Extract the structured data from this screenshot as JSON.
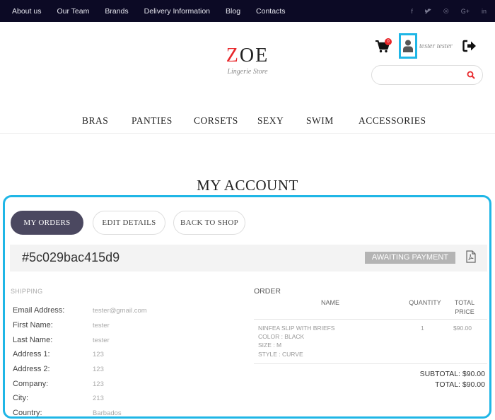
{
  "topnav": {
    "links": [
      "About us",
      "Our Team",
      "Brands",
      "Delivery Information",
      "Blog",
      "Contacts"
    ]
  },
  "social": {
    "icons": [
      "facebook-icon",
      "twitter-icon",
      "instagram-icon",
      "google-plus-icon",
      "linkedin-icon"
    ],
    "glyphs": [
      "f",
      "t",
      "◎",
      "G+",
      "in"
    ]
  },
  "header": {
    "logo_first": "Z",
    "logo_rest": "OE",
    "logo_tagline": "Lingerie Store",
    "cart_count": "0",
    "user_name": "tester tester",
    "search_placeholder": ""
  },
  "colors": {
    "topbar": "#0c0a25",
    "accent": "#e8262a",
    "highlight": "#1fb6e6",
    "active_tab": "#4b4860"
  },
  "mainnav": [
    "BRAS",
    "PANTIES",
    "CORSETS",
    "SEXY",
    "SWIM",
    "ACCESSORIES"
  ],
  "page": {
    "title": "MY ACCOUNT"
  },
  "tabs": [
    "MY ORDERS",
    "EDIT DETAILS",
    "BACK TO SHOP"
  ],
  "order": {
    "id": "#5c029bac415d9",
    "status": "AWAITING PAYMENT",
    "shipping_heading": "SHIPPING",
    "shipping": [
      {
        "label": "Email Address:",
        "value": "tester@gmail.com"
      },
      {
        "label": "First Name:",
        "value": "tester"
      },
      {
        "label": "Last Name:",
        "value": "tester"
      },
      {
        "label": "Address 1:",
        "value": "123"
      },
      {
        "label": "Address 2:",
        "value": "123"
      },
      {
        "label": "Company:",
        "value": "123"
      },
      {
        "label": "City:",
        "value": "213"
      },
      {
        "label": "Country:",
        "value": "Barbados"
      }
    ],
    "order_heading": "ORDER",
    "columns": {
      "name": "NAME",
      "quantity": "QUANTITY",
      "total_1": "TOTAL",
      "total_2": "PRICE"
    },
    "items": [
      {
        "lines": [
          "NINFEA SLIP WITH BRIEFS",
          "COLOR : BLACK",
          "SIZE : M",
          "STYLE : CURVE"
        ],
        "quantity": "1",
        "price": "$90.00"
      }
    ],
    "subtotal": "SUBTOTAL: $90.00",
    "total": "TOTAL: $90.00"
  }
}
